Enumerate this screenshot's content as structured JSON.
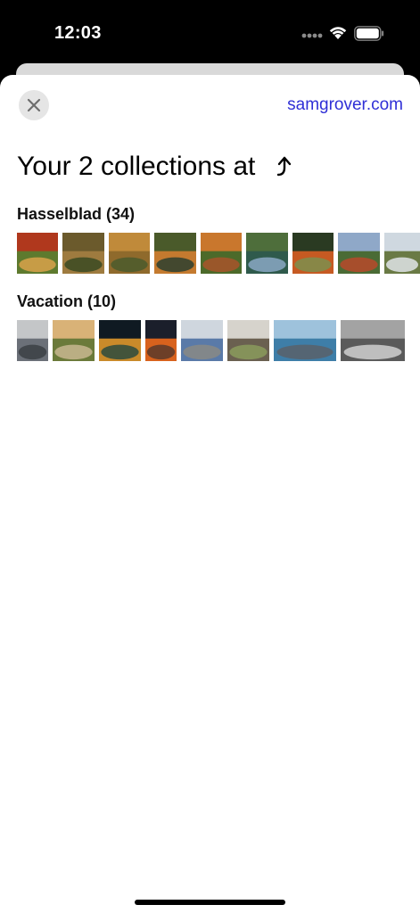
{
  "status_bar": {
    "time": "12:03",
    "icons": [
      "cellular-dots-icon",
      "wifi-icon",
      "battery-icon"
    ]
  },
  "header": {
    "close_icon": "close-icon",
    "site_link": "samgrover.com"
  },
  "page": {
    "title": "Your 2 collections at",
    "title_icon": "turn-up-arrow-icon"
  },
  "collections": [
    {
      "title": "Hasselblad (34)",
      "photos": [
        {
          "colors": [
            "#b0381d",
            "#5e7a2e",
            "#d9a24a"
          ]
        },
        {
          "colors": [
            "#6b5a2c",
            "#9e7b3f",
            "#3a4a22"
          ]
        },
        {
          "colors": [
            "#c08a3a",
            "#8f6a2c",
            "#4b5a2d"
          ]
        },
        {
          "colors": [
            "#4a5a2a",
            "#c47a2f",
            "#2d3f2f"
          ]
        },
        {
          "colors": [
            "#c9772d",
            "#4c6a2a",
            "#a8532a"
          ]
        },
        {
          "colors": [
            "#4e6e3b",
            "#2f5a4c",
            "#8aa8c4"
          ]
        },
        {
          "colors": [
            "#2a3a22",
            "#c65a22",
            "#7d8f4d"
          ]
        },
        {
          "colors": [
            "#8fa8c8",
            "#4a6b35",
            "#b7492a"
          ]
        },
        {
          "colors": [
            "#cfd8e0",
            "#6a7a45",
            "#dfe4e8"
          ]
        }
      ]
    },
    {
      "title": "Vacation (10)",
      "photos": [
        {
          "colors": [
            "#c4c6c8",
            "#6b7078",
            "#3b3f44"
          ]
        },
        {
          "colors": [
            "#d9b277",
            "#6b7a3a",
            "#c8b791"
          ]
        },
        {
          "colors": [
            "#0f1a22",
            "#c98a2a",
            "#2c4a3e"
          ]
        },
        {
          "colors": [
            "#1b1f2b",
            "#d8621d",
            "#5a3a2a"
          ]
        },
        {
          "colors": [
            "#cfd6de",
            "#5a7aa8",
            "#8a8a85"
          ]
        },
        {
          "colors": [
            "#d6d3cc",
            "#6a6050",
            "#8a9b5c"
          ]
        },
        {
          "colors": [
            "#9ec2dc",
            "#3e7ea8",
            "#59606a"
          ]
        },
        {
          "colors": [
            "#a3a3a3",
            "#5a5a5a",
            "#d0d0d0"
          ]
        }
      ]
    }
  ]
}
